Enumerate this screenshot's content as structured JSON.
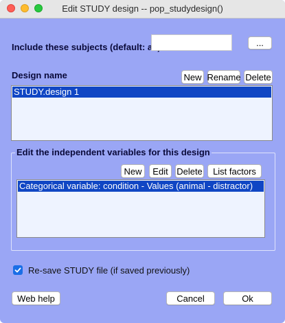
{
  "window": {
    "title": "Edit STUDY design -- pop_studydesign()"
  },
  "subjects": {
    "label": "Include these subjects (default: all)",
    "value": "",
    "browse_label": "..."
  },
  "design": {
    "label": "Design name",
    "new_label": "New",
    "rename_label": "Rename",
    "delete_label": "Delete",
    "items": [
      "STUDY.design 1"
    ],
    "selected": 0
  },
  "variables": {
    "label": "Edit the independent variables for this design",
    "new_label": "New",
    "edit_label": "Edit",
    "delete_label": "Delete",
    "list_label": "List factors",
    "items": [
      "Categorical variable: condition - Values (animal - distractor)"
    ],
    "selected": 0
  },
  "resave": {
    "label": "Re-save STUDY file (if saved previously)",
    "checked": true
  },
  "footer": {
    "help_label": "Web help",
    "cancel_label": "Cancel",
    "ok_label": "Ok"
  },
  "colors": {
    "background": "#9aa6f5",
    "selection": "#1046c4",
    "checkbox": "#1a6ee6"
  }
}
